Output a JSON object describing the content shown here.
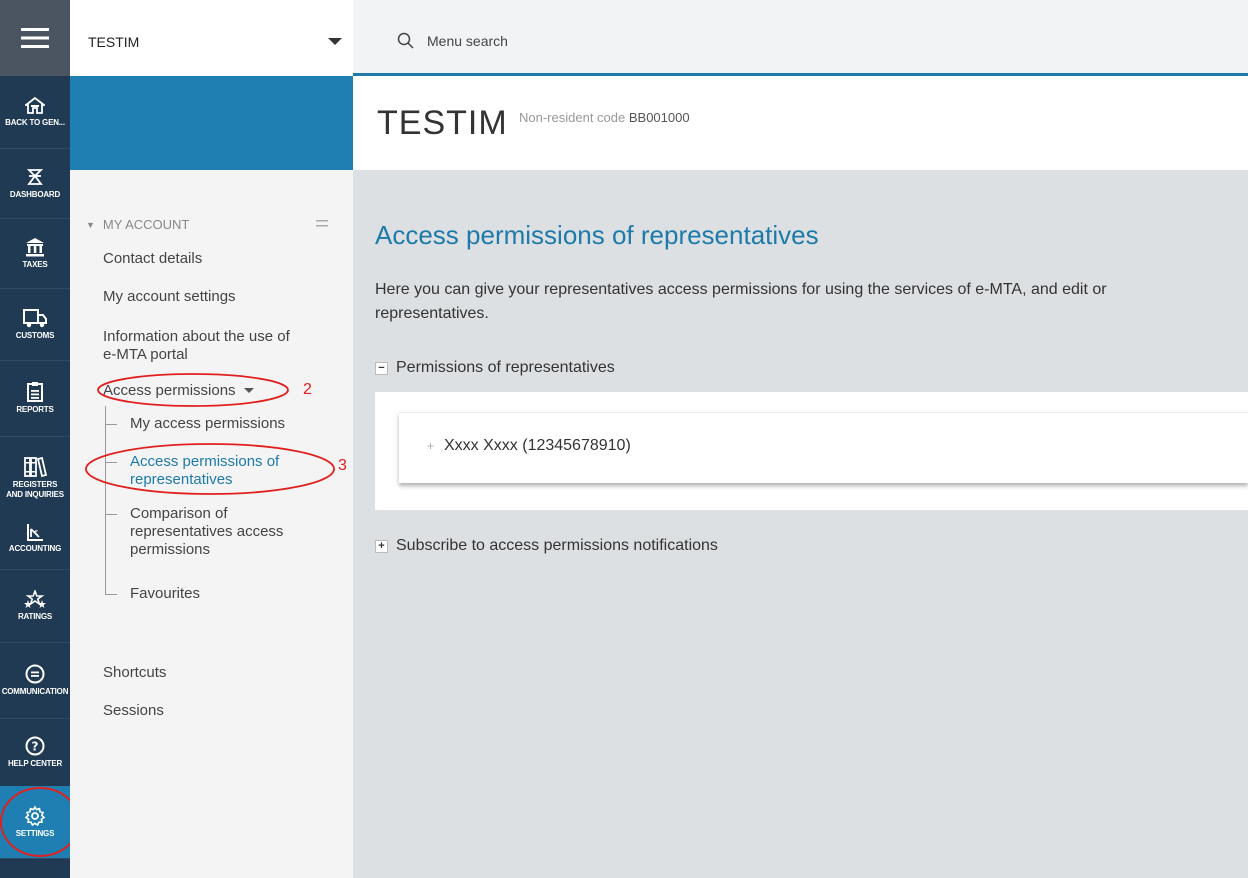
{
  "org_select": {
    "name": "TESTIM"
  },
  "search": {
    "placeholder": "Menu search"
  },
  "header": {
    "title": "TESTIM",
    "code_label": "Non-resident code",
    "code_value": "BB001000"
  },
  "rail": {
    "items": [
      {
        "label": "BACK TO GEN...",
        "icon": "home-icon"
      },
      {
        "label": "DASHBOARD",
        "icon": "dashboard-icon"
      },
      {
        "label": "TAXES",
        "icon": "bank-icon"
      },
      {
        "label": "CUSTOMS",
        "icon": "truck-icon"
      },
      {
        "label": "REPORTS",
        "icon": "report-icon"
      },
      {
        "label": "REGISTERS AND INQUIRIES",
        "icon": "books-icon"
      },
      {
        "label": "ACCOUNTING",
        "icon": "accounting-icon"
      },
      {
        "label": "RATINGS",
        "icon": "stars-icon"
      },
      {
        "label": "COMMUNICATION",
        "icon": "chat-icon"
      },
      {
        "label": "HELP CENTER",
        "icon": "help-icon"
      },
      {
        "label": "SETTINGS",
        "icon": "gear-icon",
        "active": true
      }
    ]
  },
  "sidebar": {
    "section": "MY ACCOUNT",
    "links": {
      "contact": "Contact details",
      "settings": "My account settings",
      "info_line1": "Information about the use of",
      "info_line2": "e-MTA portal",
      "access": "Access permissions"
    },
    "sub": {
      "my_access": "My access permissions",
      "rep_line1": "Access permissions of",
      "rep_line2": "representatives",
      "cmp_line1": "Comparison of",
      "cmp_line2": "representatives access",
      "cmp_line3": "permissions",
      "favourites": "Favourites"
    },
    "shortcuts": "Shortcuts",
    "sessions": "Sessions",
    "annotations": {
      "two": "2",
      "three": "3"
    }
  },
  "main": {
    "heading": "Access permissions of representatives",
    "desc_line1": "Here you can give your representatives access permissions for using the services of e-MTA, and edit or",
    "desc_line2": "representatives.",
    "permissions_toggle": "Permissions of representatives",
    "representative": "Xxxx Xxxx (12345678910)",
    "subscribe_toggle": "Subscribe to access permissions notifications"
  },
  "colors": {
    "accent": "#1d7aa9",
    "rail": "#1f3a52",
    "annotation": "#e0201e"
  }
}
